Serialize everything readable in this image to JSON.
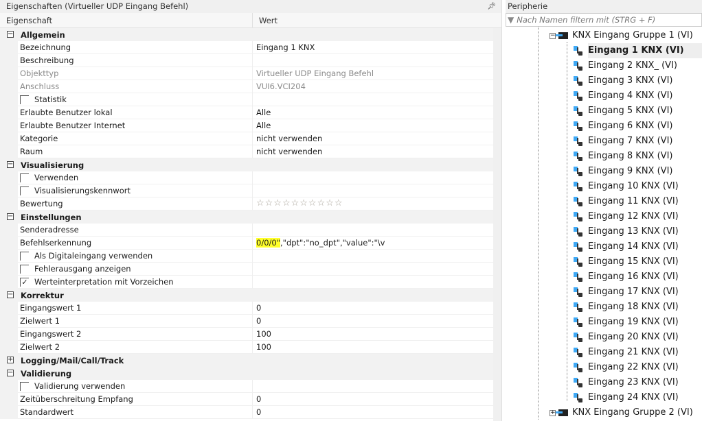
{
  "properties_panel": {
    "title": "Eigenschaften (Virtueller UDP Eingang Befehl)",
    "pin_icon": "pin-icon",
    "col_property": "Eigenschaft",
    "col_value": "Wert",
    "rows": [
      {
        "type": "group",
        "label": "Allgemein",
        "expanded": true
      },
      {
        "label": "Bezeichnung",
        "value": "Eingang 1 KNX"
      },
      {
        "label": "Beschreibung",
        "value": ""
      },
      {
        "label": "Objekttyp",
        "value": "Virtueller UDP Eingang Befehl",
        "disabled": true
      },
      {
        "label": "Anschluss",
        "value": "VUI6.VCI204",
        "disabled": true
      },
      {
        "type": "check",
        "label": "Statistik",
        "checked": false
      },
      {
        "label": "Erlaubte Benutzer lokal",
        "value": "Alle"
      },
      {
        "label": "Erlaubte Benutzer Internet",
        "value": "Alle"
      },
      {
        "label": "Kategorie",
        "value": "nicht verwenden"
      },
      {
        "label": "Raum",
        "value": "nicht verwenden"
      },
      {
        "type": "group",
        "label": "Visualisierung",
        "expanded": true
      },
      {
        "type": "check",
        "label": "Verwenden",
        "checked": false
      },
      {
        "type": "check",
        "label": "Visualisierungskennwort",
        "checked": false
      },
      {
        "type": "rating",
        "label": "Bewertung",
        "value": "☆☆☆☆☆☆☆☆☆☆",
        "rating": 0,
        "max": 10
      },
      {
        "type": "group",
        "label": "Einstellungen",
        "expanded": true
      },
      {
        "label": "Senderadresse",
        "value": ""
      },
      {
        "type": "highlight",
        "label": "Befehlserkennung",
        "value_highlight": "0/0/0\"",
        "value": ",\"dpt\":\"no_dpt\",\"value\":\"\\v"
      },
      {
        "type": "check",
        "label": "Als Digitaleingang verwenden",
        "checked": false
      },
      {
        "type": "check",
        "label": "Fehlerausgang anzeigen",
        "checked": false
      },
      {
        "type": "check",
        "label": "Werteinterpretation mit Vorzeichen",
        "checked": true
      },
      {
        "type": "group",
        "label": "Korrektur",
        "expanded": true
      },
      {
        "label": "Eingangswert 1",
        "value": "0"
      },
      {
        "label": "Zielwert 1",
        "value": "0"
      },
      {
        "label": "Eingangswert 2",
        "value": "100"
      },
      {
        "label": "Zielwert 2",
        "value": "100"
      },
      {
        "type": "group",
        "label": "Logging/Mail/Call/Track",
        "expanded": false
      },
      {
        "type": "group",
        "label": "Validierung",
        "expanded": true
      },
      {
        "type": "check",
        "label": "Validierung verwenden",
        "checked": false
      },
      {
        "label": "Zeitüberschreitung Empfang",
        "value": "0"
      },
      {
        "label": "Standardwert",
        "value": "0"
      }
    ]
  },
  "peripherie_panel": {
    "title": "Peripherie",
    "filter_placeholder": "Nach Namen filtern mit (STRG + F)",
    "group1": "KNX Eingang Gruppe 1 (VI)",
    "group2": "KNX Eingang Gruppe 2 (VI)",
    "selected_index": 0,
    "items": [
      "Eingang 1 KNX (VI)",
      "Eingang 2 KNX_ (VI)",
      "Eingang 3 KNX (VI)",
      "Eingang 4 KNX (VI)",
      "Eingang 5 KNX (VI)",
      "Eingang 6 KNX (VI)",
      "Eingang 7 KNX (VI)",
      "Eingang 8 KNX (VI)",
      "Eingang 9 KNX (VI)",
      "Eingang 10 KNX (VI)",
      "Eingang 11 KNX (VI)",
      "Eingang 12 KNX (VI)",
      "Eingang 13 KNX (VI)",
      "Eingang 14 KNX (VI)",
      "Eingang 15 KNX (VI)",
      "Eingang 16 KNX (VI)",
      "Eingang 17 KNX (VI)",
      "Eingang 18 KNX (VI)",
      "Eingang 19 KNX (VI)",
      "Eingang 20 KNX (VI)",
      "Eingang 21 KNX (VI)",
      "Eingang 22 KNX (VI)",
      "Eingang 23 KNX (VI)",
      "Eingang 24 KNX (VI)"
    ]
  }
}
